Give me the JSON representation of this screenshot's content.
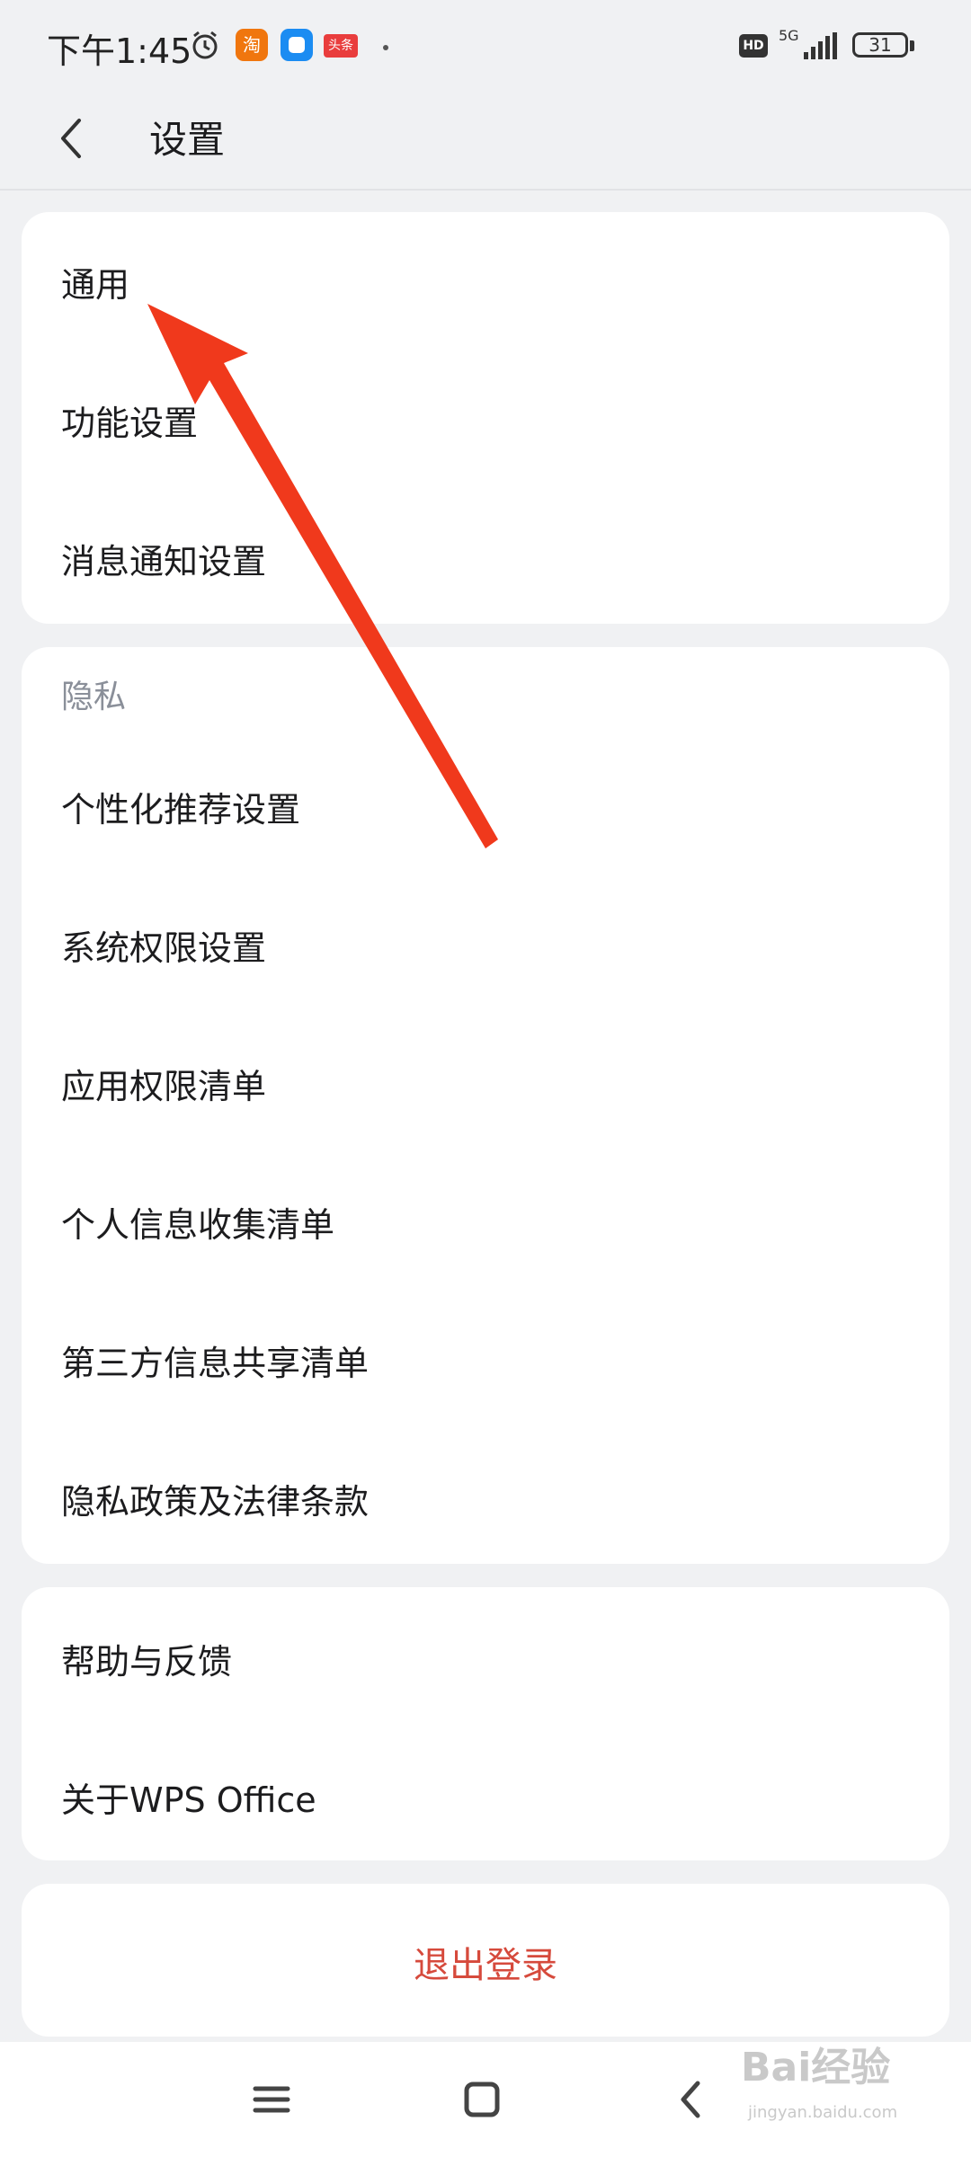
{
  "status_bar": {
    "time": "下午1:45",
    "taobao_icon_label": "淘",
    "toutiao_icon_label": "头条",
    "network": "5G",
    "hd": "HD",
    "battery": "31"
  },
  "header": {
    "title": "设置"
  },
  "card_general": {
    "items": [
      "通用",
      "功能设置",
      "消息通知设置"
    ]
  },
  "card_privacy": {
    "section_label": "隐私",
    "items": [
      "个性化推荐设置",
      "系统权限设置",
      "应用权限清单",
      "个人信息收集清单",
      "第三方信息共享清单",
      "隐私政策及法律条款"
    ]
  },
  "card_help": {
    "items": [
      "帮助与反馈",
      "关于WPS Office"
    ]
  },
  "card_logout": {
    "label": "退出登录"
  },
  "watermark": {
    "text": "Bai经验",
    "sub": "jingyan.baidu.com"
  },
  "colors": {
    "accent_red": "#d64a3c",
    "arrow_red": "#f0391c",
    "background": "#f0f1f3"
  }
}
